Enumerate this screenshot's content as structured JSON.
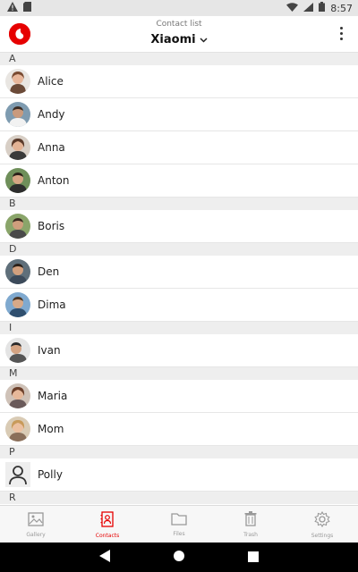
{
  "status": {
    "time": "8:57",
    "icons": [
      "warning-icon",
      "sd-card-icon",
      "wifi-icon",
      "signal-icon",
      "battery-icon"
    ]
  },
  "header": {
    "subtitle": "Contact list",
    "title": "Xiaomi",
    "logo": "vodafone-logo",
    "menu_icon": "more-vert-icon",
    "dropdown_icon": "chevron-down-icon"
  },
  "contacts": {
    "sections": [
      {
        "letter": "A",
        "items": [
          {
            "name": "Alice",
            "avatar": "photo-woman"
          },
          {
            "name": "Andy",
            "avatar": "photo-man"
          },
          {
            "name": "Anna",
            "avatar": "photo-woman"
          },
          {
            "name": "Anton",
            "avatar": "photo-man"
          }
        ]
      },
      {
        "letter": "B",
        "items": [
          {
            "name": "Boris",
            "avatar": "photo-man"
          }
        ]
      },
      {
        "letter": "D",
        "items": [
          {
            "name": "Den",
            "avatar": "photo-man"
          },
          {
            "name": "Dima",
            "avatar": "photo-man"
          }
        ]
      },
      {
        "letter": "I",
        "items": [
          {
            "name": "Ivan",
            "avatar": "photo-man"
          }
        ]
      },
      {
        "letter": "M",
        "items": [
          {
            "name": "Maria",
            "avatar": "photo-woman"
          },
          {
            "name": "Mom",
            "avatar": "photo-woman"
          }
        ]
      },
      {
        "letter": "P",
        "items": [
          {
            "name": "Polly",
            "avatar": "placeholder-person"
          }
        ]
      },
      {
        "letter": "R",
        "items": []
      }
    ]
  },
  "bottom_nav": [
    {
      "label": "Gallery",
      "icon": "gallery-icon",
      "active": false
    },
    {
      "label": "Contacts",
      "icon": "contacts-icon",
      "active": true
    },
    {
      "label": "Files",
      "icon": "folder-icon",
      "active": false
    },
    {
      "label": "Trash",
      "icon": "trash-icon",
      "active": false
    },
    {
      "label": "Settings",
      "icon": "settings-icon",
      "active": false
    }
  ],
  "colors": {
    "accent": "#e60000",
    "section_bg": "#eeeeee"
  }
}
